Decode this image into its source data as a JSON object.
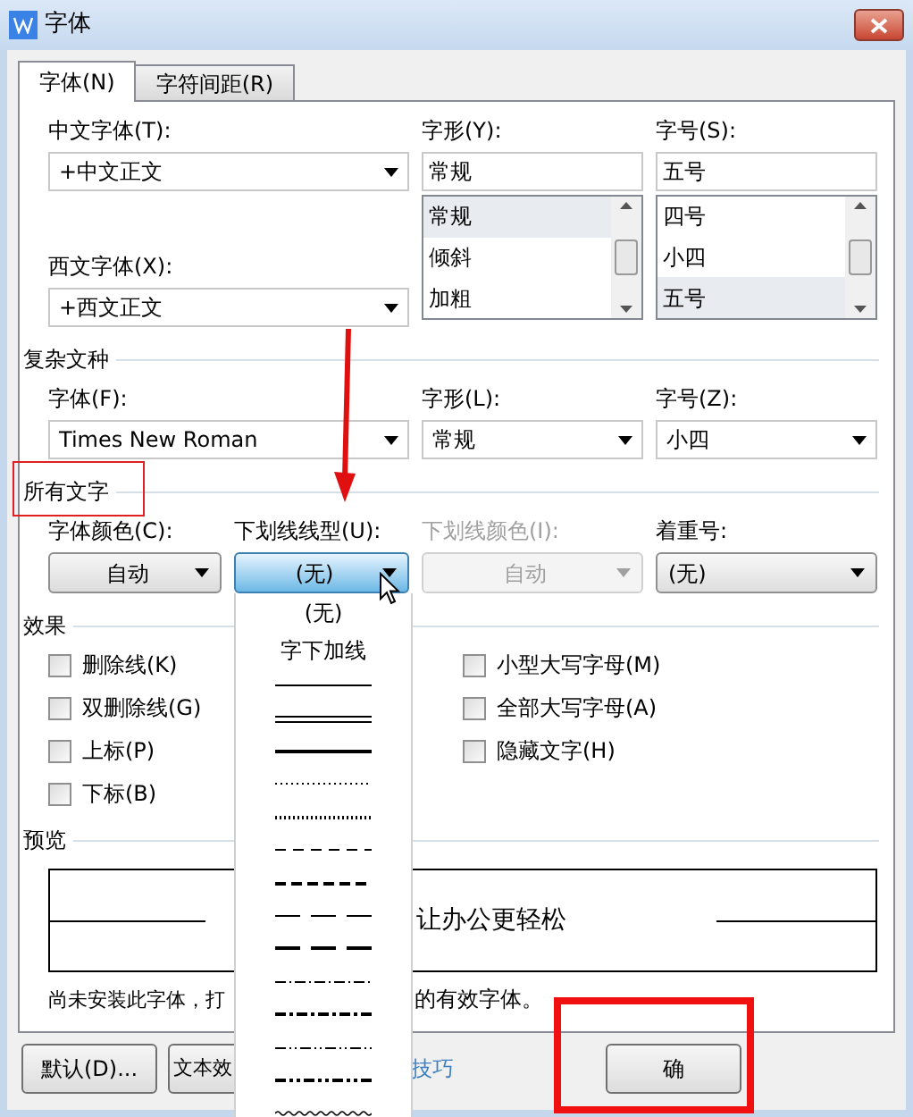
{
  "window": {
    "title": "字体"
  },
  "tabs": [
    {
      "label": "字体(N)",
      "selected": true
    },
    {
      "label": "字符间距(R)",
      "selected": false
    }
  ],
  "chinese_font": {
    "label": "中文字体(T):",
    "value": "+中文正文"
  },
  "western_font": {
    "label": "西文字体(X):",
    "value": "+西文正文"
  },
  "style": {
    "label": "字形(Y):",
    "value": "常规",
    "items": [
      {
        "label": "常规",
        "selected": true
      },
      {
        "label": "倾斜",
        "selected": false
      },
      {
        "label": "加粗",
        "selected": false
      }
    ]
  },
  "size": {
    "label": "字号(S):",
    "value": "五号",
    "items": [
      {
        "label": "四号",
        "selected": false
      },
      {
        "label": "小四",
        "selected": false
      },
      {
        "label": "五号",
        "selected": true
      }
    ]
  },
  "complex": {
    "title": "复杂文种",
    "fields": [
      {
        "label": "字体(F):",
        "value": "Times New Roman"
      },
      {
        "label": "字形(L):",
        "value": "常规"
      },
      {
        "label": "字号(Z):",
        "value": "小四"
      }
    ]
  },
  "all_text": {
    "title": "所有文字",
    "fields": [
      {
        "label": "字体颜色(C):",
        "value": "自动",
        "kind": "button",
        "disabled": false,
        "focused": false
      },
      {
        "label": "下划线线型(U):",
        "value": "(无)",
        "kind": "button",
        "disabled": false,
        "focused": true
      },
      {
        "label": "下划线颜色(I):",
        "value": "自动",
        "kind": "button",
        "disabled": true,
        "focused": false
      },
      {
        "label": "着重号:",
        "value": "(无)",
        "kind": "combo",
        "disabled": false,
        "focused": false
      }
    ]
  },
  "effects": {
    "title": "效果",
    "left": [
      {
        "label": "删除线(K)",
        "checked": false
      },
      {
        "label": "双删除线(G)",
        "checked": false
      },
      {
        "label": "上标(P)",
        "checked": false
      },
      {
        "label": "下标(B)",
        "checked": false
      }
    ],
    "right": [
      {
        "label": "小型大写字母(M)",
        "checked": false
      },
      {
        "label": "全部大写字母(A)",
        "checked": false
      },
      {
        "label": "隐藏文字(H)",
        "checked": false
      }
    ]
  },
  "preview": {
    "title": "预览",
    "text": "让办公更轻松"
  },
  "hint": [
    "尚未安装此字体，打",
    "的有效字体。"
  ],
  "buttons": [
    {
      "label": "默认(D)...",
      "kind": "button"
    },
    {
      "label": "文本效",
      "kind": "button"
    },
    {
      "label": "技巧",
      "kind": "link"
    },
    {
      "label": "确",
      "kind": "button"
    }
  ],
  "underline_menu": [
    {
      "kind": "text",
      "label": "(无)"
    },
    {
      "kind": "text",
      "label": "字下加线"
    },
    {
      "kind": "solid"
    },
    {
      "kind": "double"
    },
    {
      "kind": "thick"
    },
    {
      "kind": "dotted"
    },
    {
      "kind": "dottedheavy"
    },
    {
      "kind": "dash"
    },
    {
      "kind": "dashheavy"
    },
    {
      "kind": "longdash"
    },
    {
      "kind": "longdashheavy"
    },
    {
      "kind": "dashdot"
    },
    {
      "kind": "dashdotheavy"
    },
    {
      "kind": "dashdotdot"
    },
    {
      "kind": "dashdotdotheavy"
    },
    {
      "kind": "wave"
    }
  ]
}
